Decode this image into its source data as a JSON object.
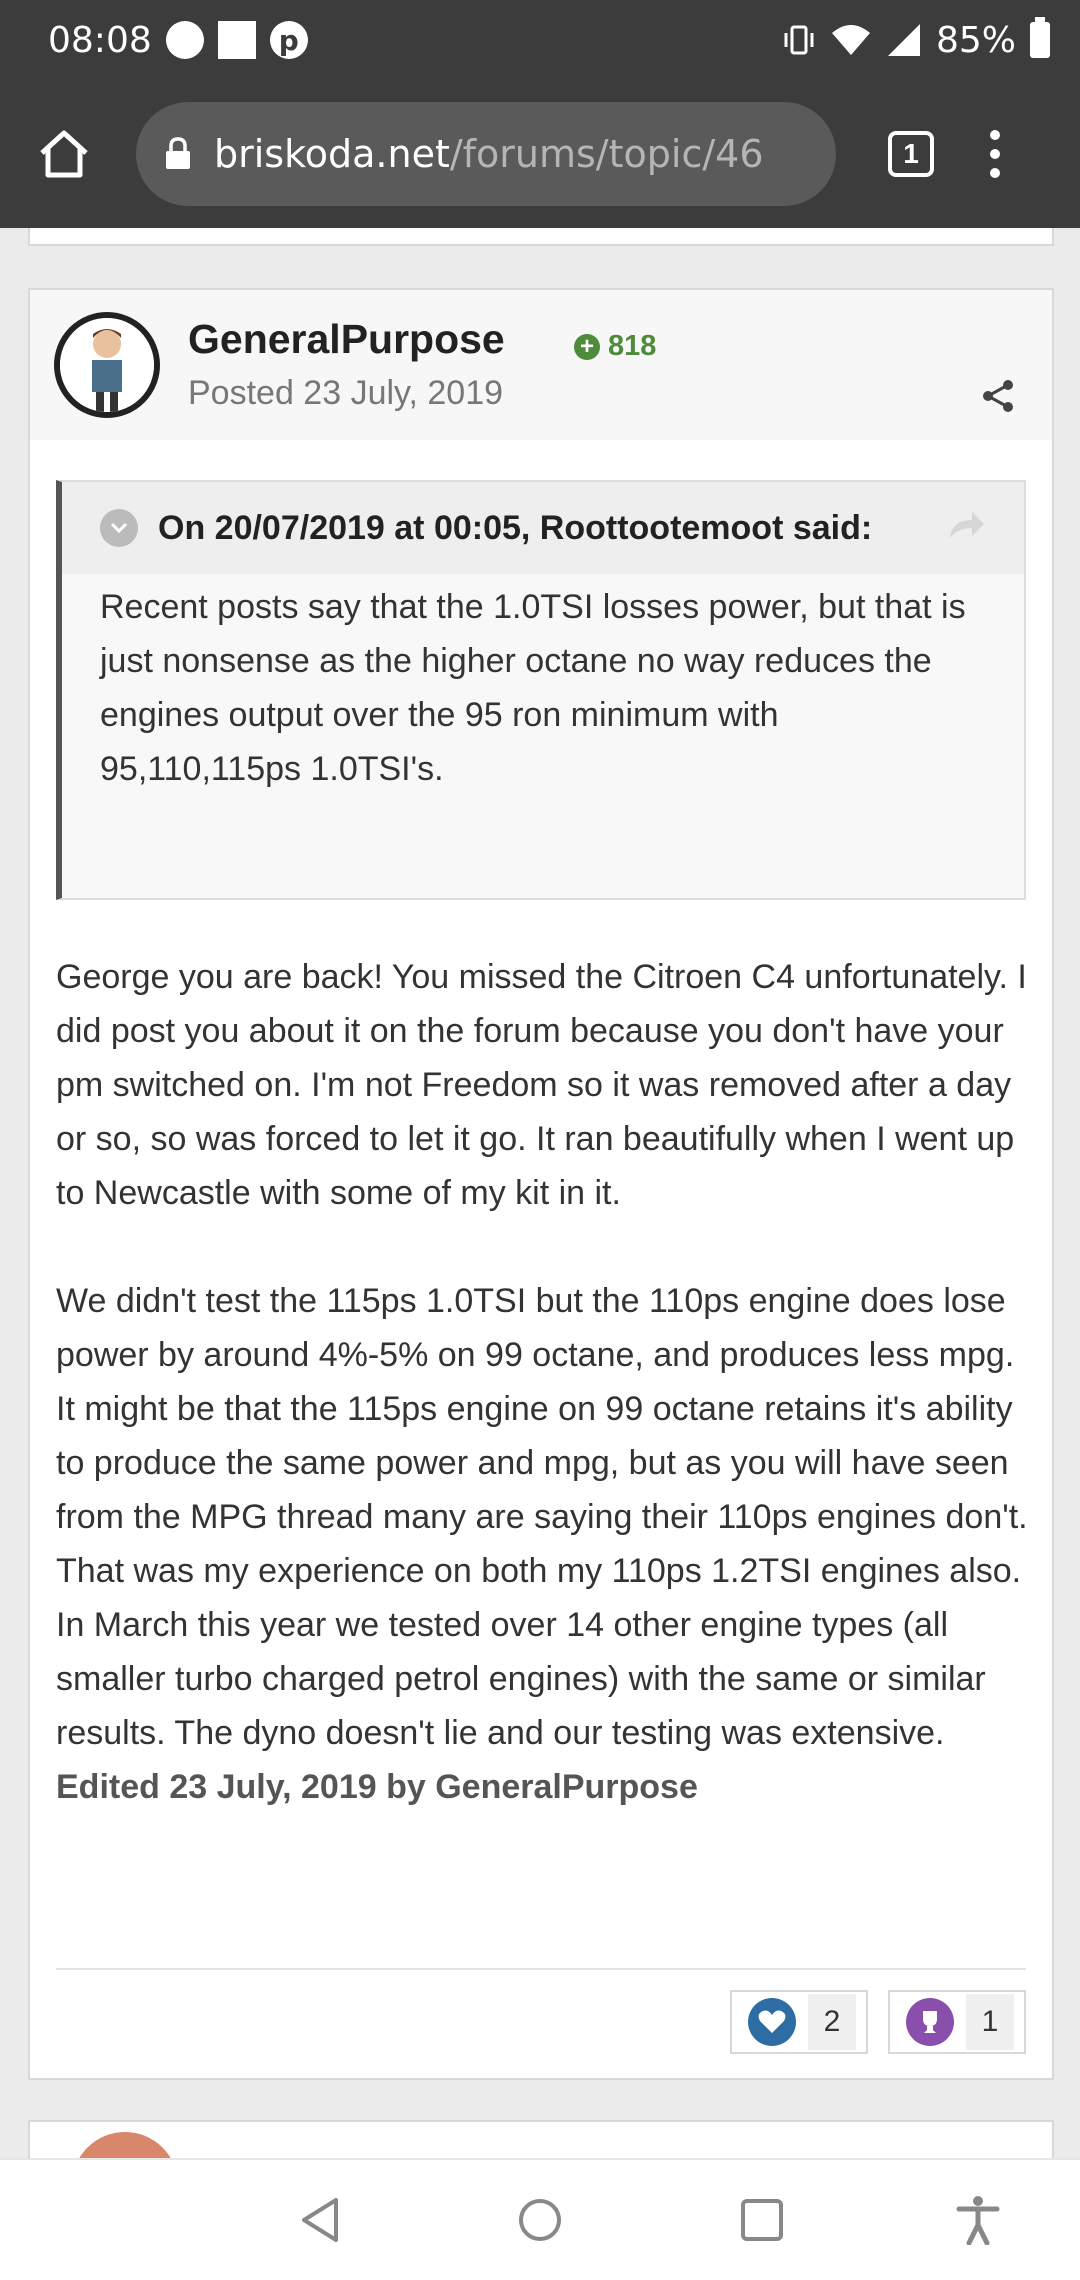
{
  "status_bar": {
    "time": "08:08",
    "battery": "85%",
    "icons": [
      "circle-icon",
      "square-icon",
      "pinterest-icon",
      "vibrate-icon",
      "wifi-icon",
      "signal-icon",
      "battery-icon"
    ]
  },
  "browser": {
    "url_domain": "briskoda.net",
    "url_path": "/forums/topic/46",
    "tab_count": "1"
  },
  "post": {
    "username": "GeneralPurpose",
    "reputation": "818",
    "posted": "Posted 23 July, 2019",
    "quote": {
      "header": "On 20/07/2019 at 00:05, Roottootemoot said:",
      "text": "Recent posts say that the 1.0TSI losses power, but that is just nonsense as the higher octane no way reduces the engines output over the 95 ron minimum with 95,110,115ps 1.0TSI's."
    },
    "paragraphs": [
      "George you are back! You missed the Citroen C4 unfortunately. I did post you about it on the forum because you don't have your pm switched on. I'm not Freedom so it was removed after a day or so, so was forced to let it go. It ran beautifully when I went up to Newcastle with some of my kit in it.",
      "We didn't test the 115ps 1.0TSI but the 110ps engine does lose power by around 4%-5% on 99 octane, and produces less mpg. It might be that the 115ps engine on 99 octane retains it's ability to produce the same power and mpg, but as you will have seen from the MPG thread many are saying their 110ps engines don't. That was my experience on both my 110ps 1.2TSI engines also. In March this year we tested over 14 other engine types (all smaller turbo charged petrol engines) with the same or similar results. The dyno doesn't lie and our testing was extensive."
    ],
    "edited": "Edited 23 July, 2019 by GeneralPurpose",
    "reactions": {
      "like_count": "2",
      "trophy_count": "1"
    }
  },
  "colors": {
    "status_bar": "#3c3c3c",
    "reputation": "#4e8b3a",
    "like": "#2e6da4",
    "trophy": "#8a4fad"
  }
}
